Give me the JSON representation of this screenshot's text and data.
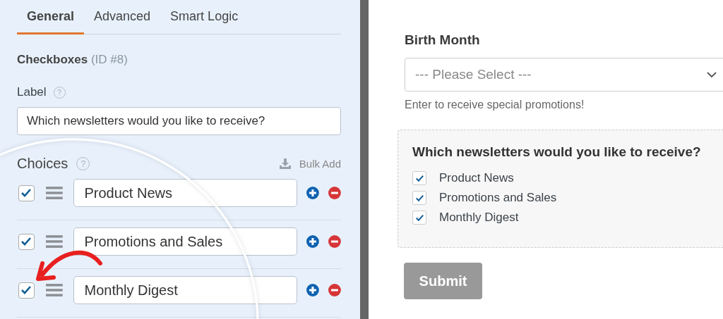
{
  "tabs": [
    {
      "label": "General",
      "selected": true
    },
    {
      "label": "Advanced",
      "selected": false
    },
    {
      "label": "Smart Logic",
      "selected": false
    }
  ],
  "field": {
    "title": "Checkboxes",
    "id": "(ID #8)"
  },
  "label_setting": {
    "label": "Label",
    "help": "?",
    "value": "Which newsletters would you like to receive?"
  },
  "choices_setting": {
    "label": "Choices",
    "help": "?",
    "bulk_add": "Bulk Add",
    "choices": [
      {
        "value": "Product News",
        "checked": true
      },
      {
        "value": "Promotions and Sales",
        "checked": true
      },
      {
        "value": "Monthly Digest",
        "checked": true
      }
    ]
  },
  "preview": {
    "select_label": "Birth Month",
    "select_placeholder": "--- Please Select ---",
    "select_hint": "Enter to receive special promotions!",
    "checkbox_label": "Which newsletters would you like to receive?",
    "options": [
      {
        "label": "Product News",
        "checked": true
      },
      {
        "label": "Promotions and Sales",
        "checked": true
      },
      {
        "label": "Monthly Digest",
        "checked": true
      }
    ],
    "submit": "Submit"
  }
}
